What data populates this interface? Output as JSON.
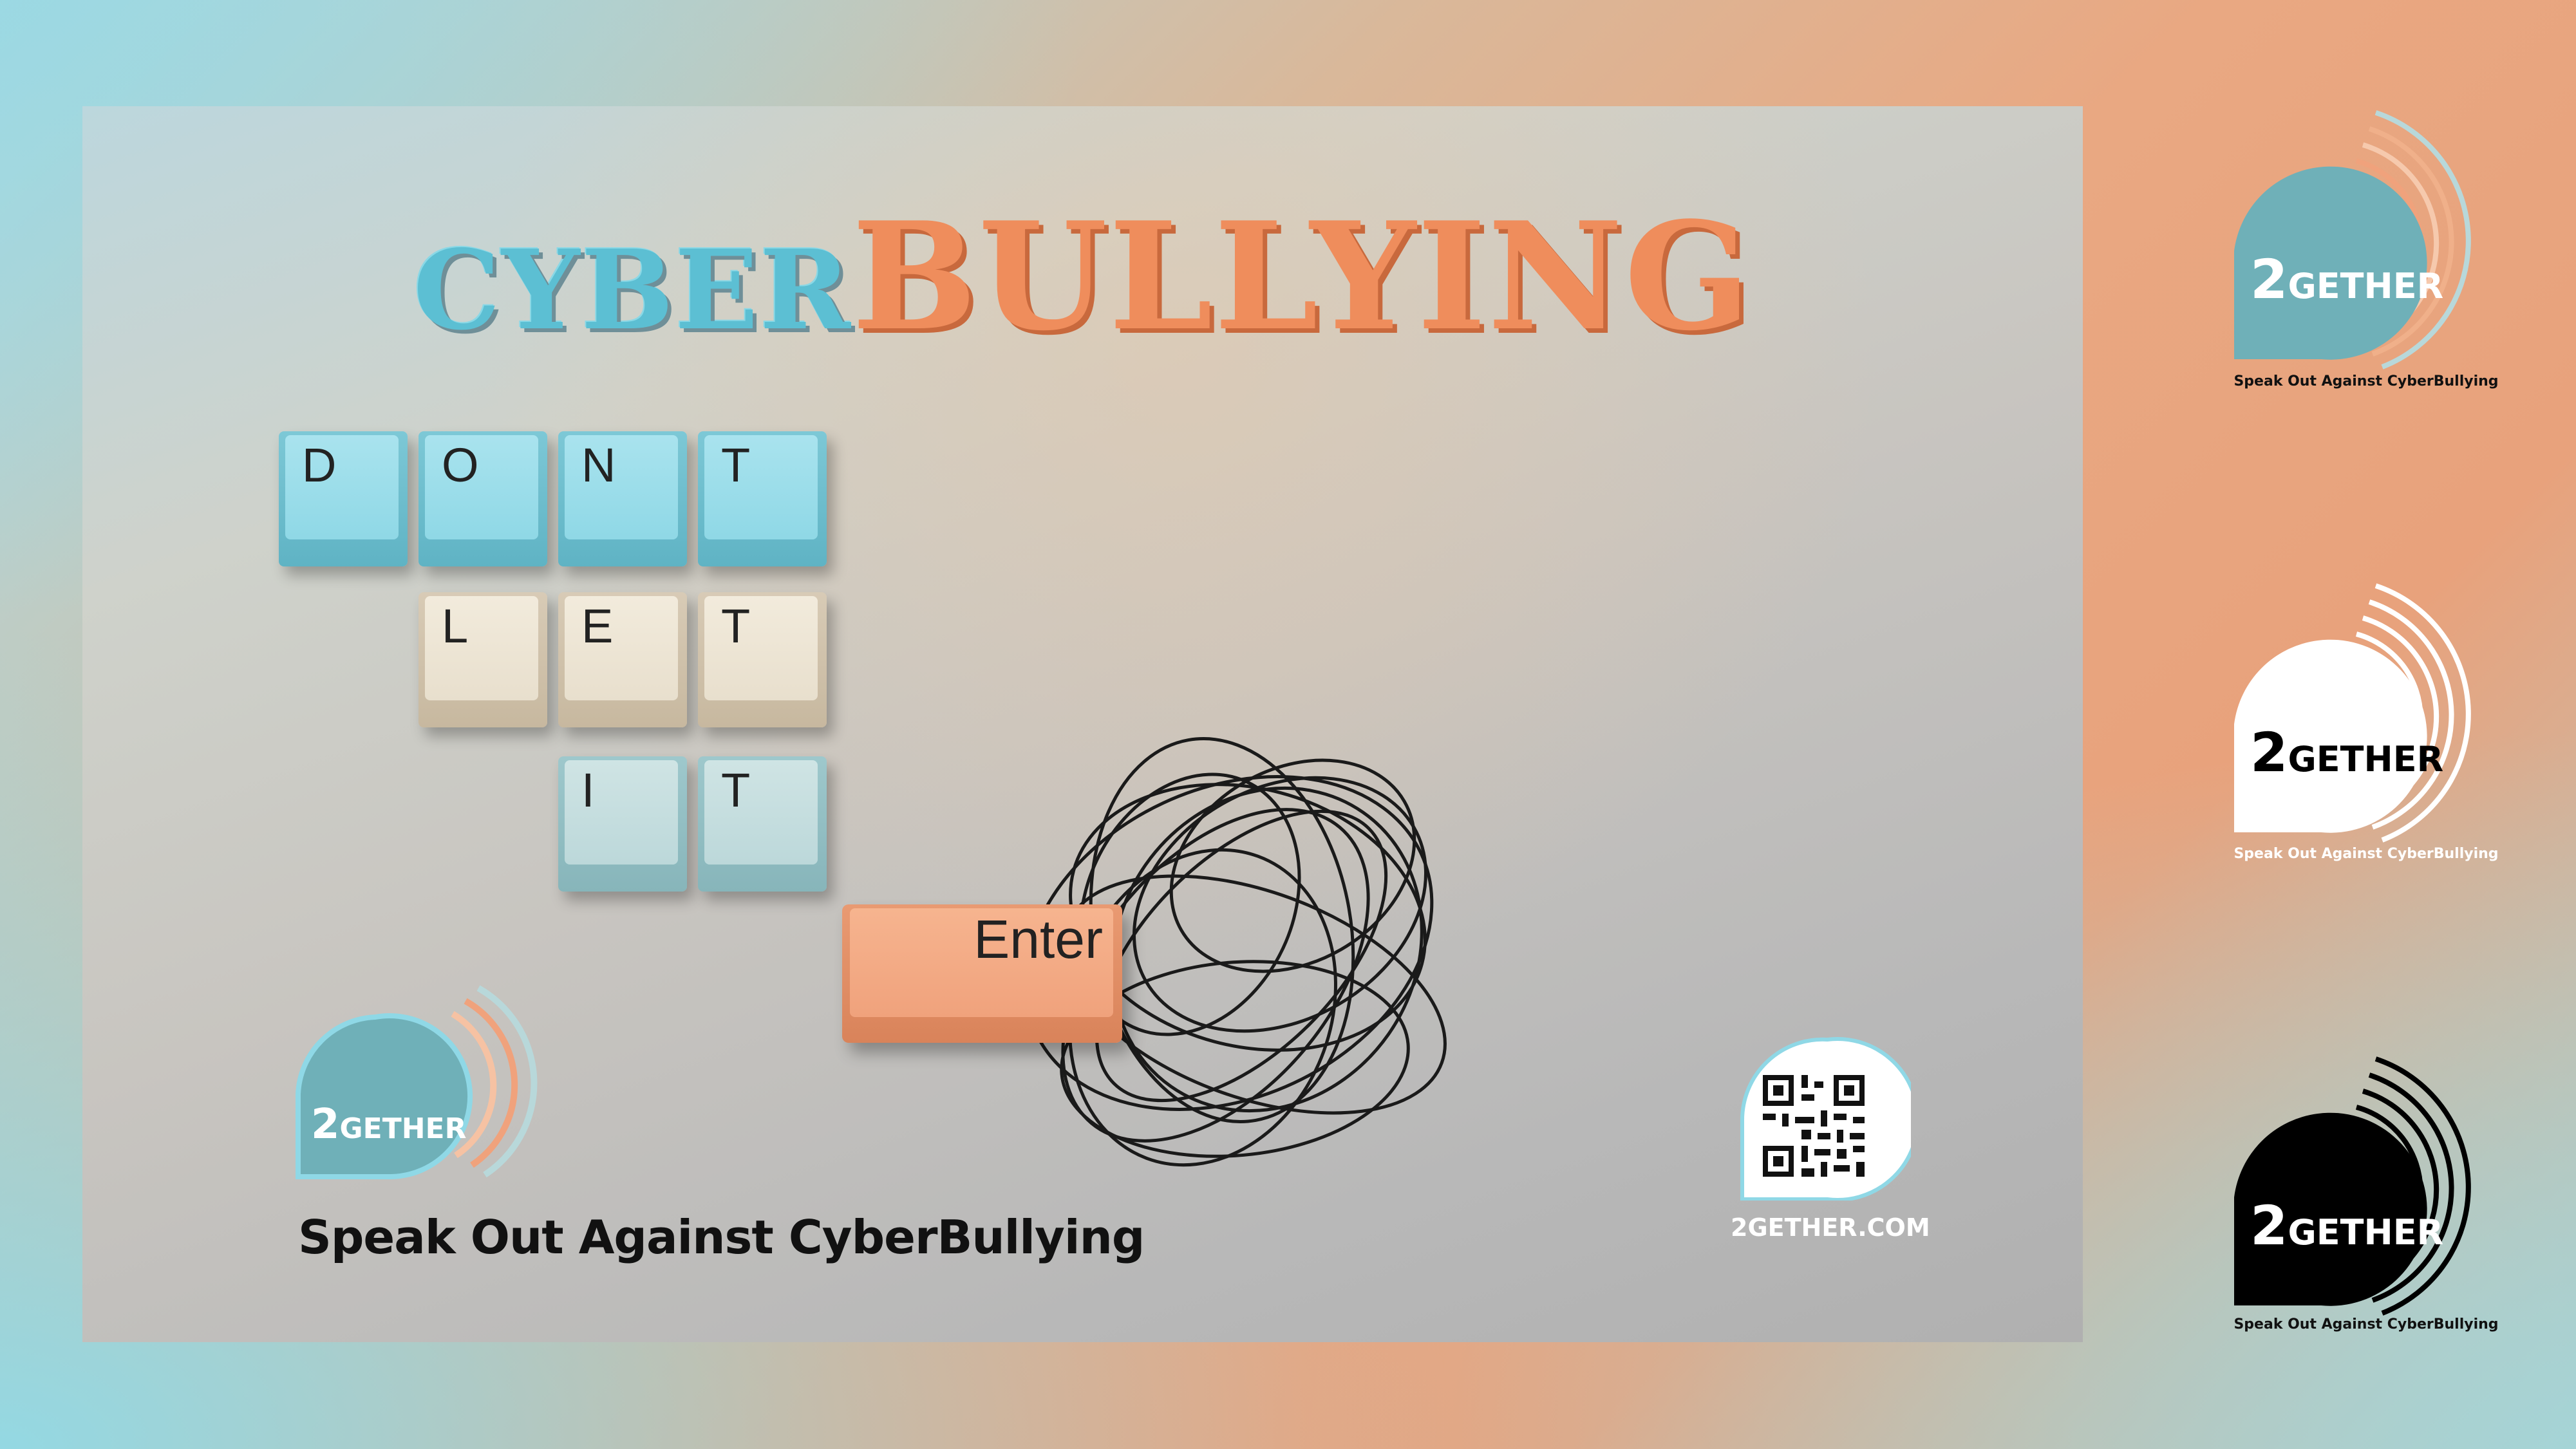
{
  "poster": {
    "title_part1": "CYBER",
    "title_part2": "BULLYING",
    "keys_row1": [
      "D",
      "O",
      "N",
      "T"
    ],
    "keys_row2": [
      "L",
      "E",
      "T"
    ],
    "keys_row3": [
      "I",
      "T"
    ],
    "enter_key": "Enter",
    "logo": {
      "num": "2",
      "word": "GETHER"
    },
    "tagline": "Speak Out Against CyberBullying",
    "website": "2GETHER.COM"
  },
  "side_logos": [
    {
      "num": "2",
      "word": "GETHER",
      "tagline": "Speak Out Against CyberBullying",
      "variant": "teal",
      "color": "#6fb0b8"
    },
    {
      "num": "2",
      "word": "GETHER",
      "tagline": "Speak Out Against CyberBullying",
      "variant": "white",
      "color": "#ffffff"
    },
    {
      "num": "2",
      "word": "GETHER",
      "tagline": "Speak Out Against CyberBullying",
      "variant": "black",
      "color": "#000000"
    }
  ],
  "colors": {
    "teal": "#5cbfd3",
    "orange": "#ef8d5c",
    "logo_teal": "#6fb0b8"
  }
}
